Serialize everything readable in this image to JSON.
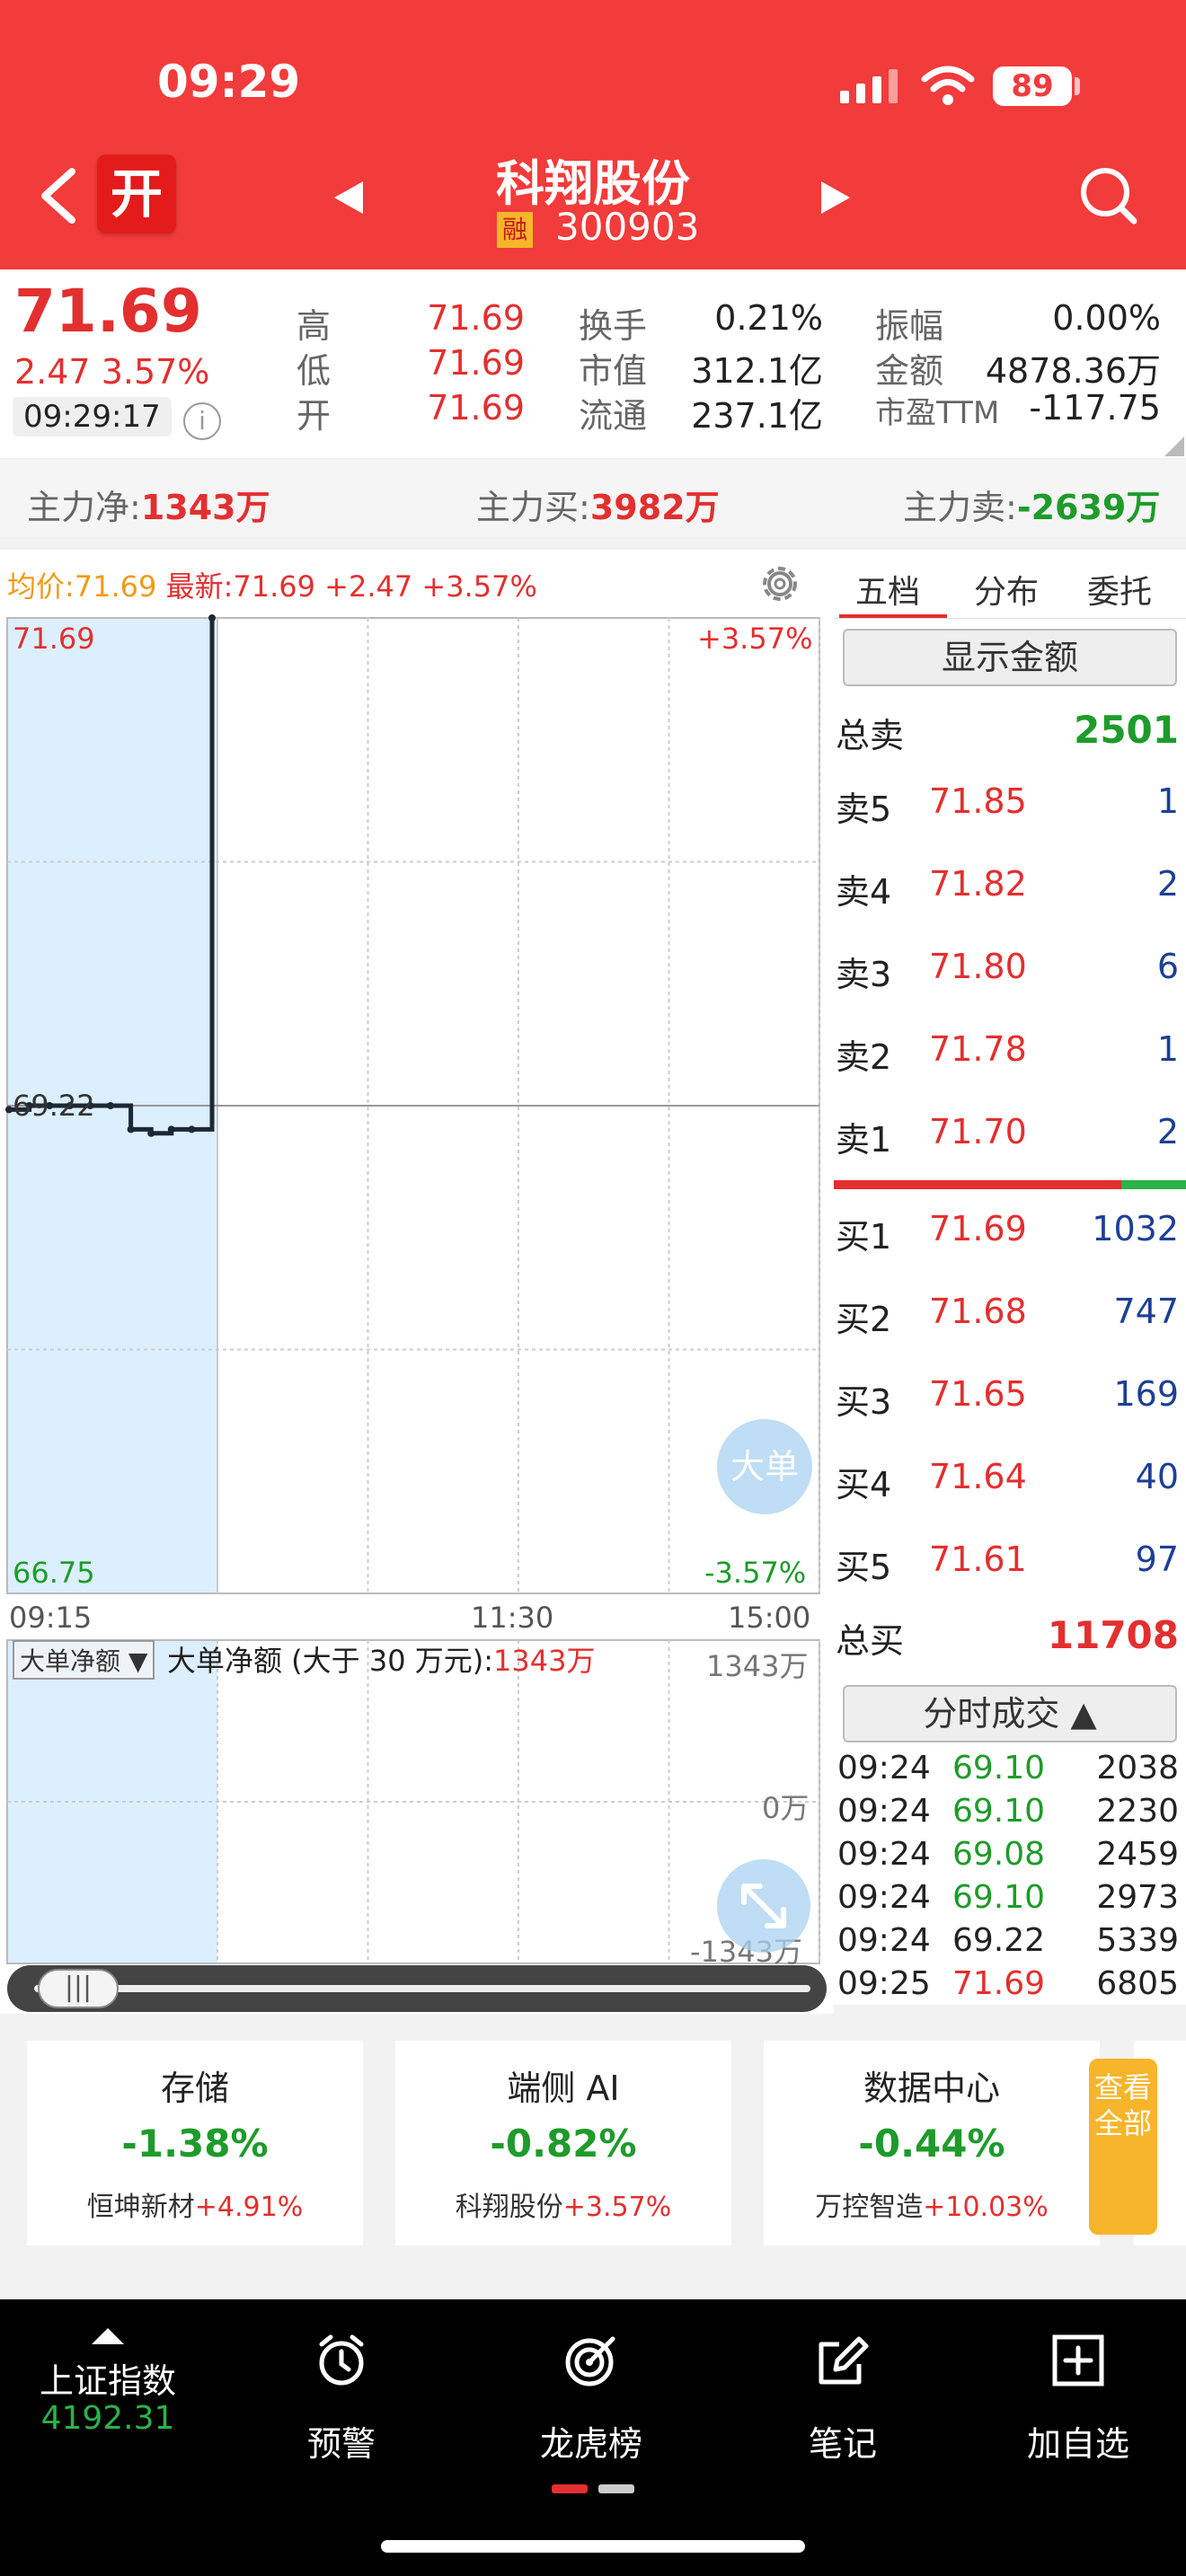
{
  "status": {
    "time": "09:29",
    "battery": "89"
  },
  "header": {
    "open_badge": "开",
    "stock_name": "科翔股份",
    "margin_badge": "融",
    "stock_code": "300903"
  },
  "quote": {
    "price": "71.69",
    "change": "2.47 3.57%",
    "time": "09:29:17",
    "stats": [
      {
        "label": "高",
        "value": "71.69"
      },
      {
        "label": "换手",
        "value": "0.21%"
      },
      {
        "label": "振幅",
        "value": "0.00%"
      },
      {
        "label": "低",
        "value": "71.69"
      },
      {
        "label": "市值",
        "value": "312.1亿"
      },
      {
        "label": "金额",
        "value": "4878.36万"
      },
      {
        "label": "开",
        "value": "71.69"
      },
      {
        "label": "流通",
        "value": "237.1亿"
      },
      {
        "label": "市盈TTM",
        "value": "-117.75"
      }
    ]
  },
  "fund_flow": {
    "net_label": "主力净:",
    "net_value": "1343万",
    "buy_label": "主力买:",
    "buy_value": "3982万",
    "sell_label": "主力卖:",
    "sell_value": "-2639万"
  },
  "chart": {
    "avg_label": "均价:71.69",
    "latest_label": "最新:71.69 +2.47 +3.57%",
    "y_top": "71.69",
    "y_mid": "69.22",
    "y_bottom": "66.75",
    "pct_top": "+3.57%",
    "pct_bottom": "-3.57%",
    "x_start": "09:15",
    "x_mid": "11:30",
    "x_end": "15:00",
    "big_order_btn": "大单",
    "sub_selector": "大单净额",
    "sub_title": "大单净额 (大于 30 万元):",
    "sub_value": "1343万",
    "sub_top": "1343万",
    "sub_mid": "0万",
    "sub_bottom": "-1343万"
  },
  "chart_data": {
    "type": "line",
    "title": "",
    "x": [
      "09:15",
      "09:16",
      "09:17",
      "09:18",
      "09:19",
      "09:20",
      "09:21",
      "09:22",
      "09:23",
      "09:24",
      "09:25"
    ],
    "series": [
      {
        "values": [
          69.2,
          69.22,
          69.22,
          69.22,
          69.22,
          69.22,
          69.1,
          69.08,
          69.1,
          69.1,
          71.69
        ]
      }
    ],
    "ylim": [
      66.75,
      71.69
    ],
    "xlim": [
      "09:15",
      "15:00"
    ],
    "grid": true
  },
  "side": {
    "tabs": [
      "五档",
      "分布",
      "委托"
    ],
    "show_amount": "显示金额",
    "total_sell_label": "总卖",
    "total_sell": "2501",
    "asks": [
      {
        "label": "卖5",
        "price": "71.85",
        "vol": "1"
      },
      {
        "label": "卖4",
        "price": "71.82",
        "vol": "2"
      },
      {
        "label": "卖3",
        "price": "71.80",
        "vol": "6"
      },
      {
        "label": "卖2",
        "price": "71.78",
        "vol": "1"
      },
      {
        "label": "卖1",
        "price": "71.70",
        "vol": "2"
      }
    ],
    "bids": [
      {
        "label": "买1",
        "price": "71.69",
        "vol": "1032"
      },
      {
        "label": "买2",
        "price": "71.68",
        "vol": "747"
      },
      {
        "label": "买3",
        "price": "71.65",
        "vol": "169"
      },
      {
        "label": "买4",
        "price": "71.64",
        "vol": "40"
      },
      {
        "label": "买5",
        "price": "71.61",
        "vol": "97"
      }
    ],
    "total_buy_label": "总买",
    "total_buy": "11708",
    "trades_btn": "分时成交",
    "trades": [
      {
        "time": "09:24",
        "price": "69.10",
        "vol": "2038",
        "dir": "down"
      },
      {
        "time": "09:24",
        "price": "69.10",
        "vol": "2230",
        "dir": "down"
      },
      {
        "time": "09:24",
        "price": "69.08",
        "vol": "2459",
        "dir": "down"
      },
      {
        "time": "09:24",
        "price": "69.10",
        "vol": "2973",
        "dir": "down"
      },
      {
        "time": "09:24",
        "price": "69.22",
        "vol": "5339",
        "dir": "flat"
      },
      {
        "time": "09:25",
        "price": "71.69",
        "vol": "6805",
        "dir": "up"
      }
    ]
  },
  "sectors": {
    "cards": [
      {
        "name": "存储",
        "pct": "-1.38%",
        "leader": "恒坤新材",
        "leader_pct": "+4.91%"
      },
      {
        "name": "端侧 AI",
        "pct": "-0.82%",
        "leader": "科翔股份",
        "leader_pct": "+3.57%"
      },
      {
        "name": "数据中心",
        "pct": "-0.44%",
        "leader": "万控智造",
        "leader_pct": "+10.03%"
      }
    ],
    "view_all": "查看全部"
  },
  "nav": {
    "index_name": "上证指数",
    "index_value": "4192.31",
    "alert": "预警",
    "dragon": "龙虎榜",
    "notes": "笔记",
    "add_watch": "加自选"
  },
  "colors": {
    "header_red": "#f23b3b",
    "up_red": "#e32f2f",
    "down_green": "#1e9b2a",
    "vol_blue": "#1d3f95",
    "accent_orange": "#f7b52b"
  }
}
